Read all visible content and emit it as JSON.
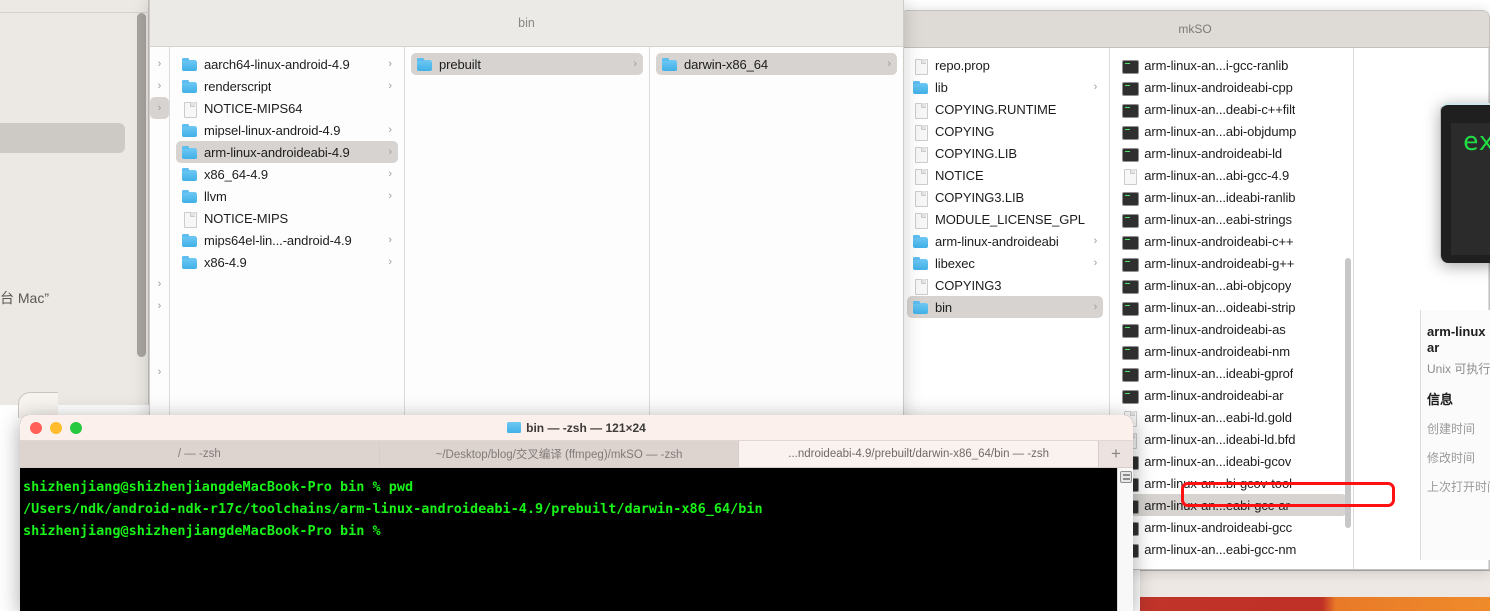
{
  "windows": {
    "bin_window": {
      "title": "bin"
    },
    "mkso_window": {
      "title": "mkSO"
    },
    "left_window": {
      "fragment_text": "台 Mac”"
    },
    "right_terminal_sliver": {
      "text": "ex"
    }
  },
  "finder": {
    "column_1_chevron_only": {
      "note": "",
      "rows": [
        {
          "chevron": "›",
          "selected": false
        },
        {
          "chevron": "›",
          "selected": false
        },
        {
          "chevron": "›",
          "selected": true
        },
        {
          "chevron": "",
          "selected": false
        },
        {
          "chevron": "",
          "selected": false
        },
        {
          "chevron": "",
          "selected": false
        },
        {
          "chevron": "",
          "selected": false
        },
        {
          "chevron": "",
          "selected": false
        },
        {
          "chevron": "",
          "selected": false
        },
        {
          "chevron": "",
          "selected": false
        },
        {
          "chevron": "›",
          "selected": false
        },
        {
          "chevron": "›",
          "selected": false
        },
        {
          "chevron": "",
          "selected": false
        },
        {
          "chevron": "",
          "selected": false
        },
        {
          "chevron": "›",
          "selected": false
        },
        {
          "chevron": "",
          "selected": false
        },
        {
          "chevron": "",
          "selected": false
        },
        {
          "chevron": "›",
          "selected": false
        },
        {
          "chevron": "›",
          "selected": false
        },
        {
          "chevron": "›",
          "selected": false
        }
      ]
    },
    "column_toolchains": {
      "items": [
        {
          "name": "aarch64-linux-android-4.9",
          "icon": "folder-icon",
          "chevron": "›",
          "selected": false
        },
        {
          "name": "renderscript",
          "icon": "folder-icon",
          "chevron": "›",
          "selected": false
        },
        {
          "name": "NOTICE-MIPS64",
          "icon": "document-icon",
          "chevron": "",
          "selected": false
        },
        {
          "name": "mipsel-linux-android-4.9",
          "icon": "folder-icon",
          "chevron": "›",
          "selected": false
        },
        {
          "name": "arm-linux-androideabi-4.9",
          "icon": "folder-icon",
          "chevron": "›",
          "selected": true
        },
        {
          "name": "x86_64-4.9",
          "icon": "folder-icon",
          "chevron": "›",
          "selected": false
        },
        {
          "name": "llvm",
          "icon": "folder-icon",
          "chevron": "›",
          "selected": false
        },
        {
          "name": "NOTICE-MIPS",
          "icon": "document-icon",
          "chevron": "",
          "selected": false
        },
        {
          "name": "mips64el-lin...-android-4.9",
          "icon": "folder-icon",
          "chevron": "›",
          "selected": false
        },
        {
          "name": "x86-4.9",
          "icon": "folder-icon",
          "chevron": "›",
          "selected": false
        }
      ]
    },
    "column_prebuilt": {
      "items": [
        {
          "name": "prebuilt",
          "icon": "folder-icon",
          "chevron": "›",
          "selected": true
        }
      ]
    },
    "column_darwin": {
      "items": [
        {
          "name": "darwin-x86_64",
          "icon": "folder-icon",
          "chevron": "›",
          "selected": true
        }
      ]
    },
    "column_darwin_contents": {
      "items": [
        {
          "name": "repo.prop",
          "icon": "document-icon",
          "chevron": "",
          "selected": false
        },
        {
          "name": "lib",
          "icon": "folder-icon",
          "chevron": "›",
          "selected": false
        },
        {
          "name": "COPYING.RUNTIME",
          "icon": "document-icon",
          "chevron": "",
          "selected": false
        },
        {
          "name": "COPYING",
          "icon": "document-icon",
          "chevron": "",
          "selected": false
        },
        {
          "name": "COPYING.LIB",
          "icon": "document-icon",
          "chevron": "",
          "selected": false
        },
        {
          "name": "NOTICE",
          "icon": "document-icon",
          "chevron": "",
          "selected": false
        },
        {
          "name": "COPYING3.LIB",
          "icon": "document-icon",
          "chevron": "",
          "selected": false
        },
        {
          "name": "MODULE_LICENSE_GPL",
          "icon": "document-icon",
          "chevron": "",
          "selected": false
        },
        {
          "name": "arm-linux-androideabi",
          "icon": "folder-icon",
          "chevron": "›",
          "selected": false
        },
        {
          "name": "libexec",
          "icon": "folder-icon",
          "chevron": "›",
          "selected": false
        },
        {
          "name": "COPYING3",
          "icon": "document-icon",
          "chevron": "",
          "selected": false
        },
        {
          "name": "bin",
          "icon": "folder-icon",
          "chevron": "›",
          "selected": true
        }
      ]
    },
    "column_bin_contents": {
      "items": [
        {
          "name": "arm-linux-an...i-gcc-ranlib",
          "icon": "unix-executable-icon",
          "selected": false,
          "highlighted": false
        },
        {
          "name": "arm-linux-androideabi-cpp",
          "icon": "unix-executable-icon",
          "selected": false,
          "highlighted": false
        },
        {
          "name": "arm-linux-an...deabi-c++filt",
          "icon": "unix-executable-icon",
          "selected": false,
          "highlighted": false
        },
        {
          "name": "arm-linux-an...abi-objdump",
          "icon": "unix-executable-icon",
          "selected": false,
          "highlighted": false
        },
        {
          "name": "arm-linux-androideabi-ld",
          "icon": "unix-executable-icon",
          "selected": false,
          "highlighted": false
        },
        {
          "name": "arm-linux-an...abi-gcc-4.9",
          "icon": "document-icon",
          "selected": false,
          "highlighted": false
        },
        {
          "name": "arm-linux-an...ideabi-ranlib",
          "icon": "unix-executable-icon",
          "selected": false,
          "highlighted": false
        },
        {
          "name": "arm-linux-an...eabi-strings",
          "icon": "unix-executable-icon",
          "selected": false,
          "highlighted": false
        },
        {
          "name": "arm-linux-androideabi-c++",
          "icon": "unix-executable-icon",
          "selected": false,
          "highlighted": false
        },
        {
          "name": "arm-linux-androideabi-g++",
          "icon": "unix-executable-icon",
          "selected": false,
          "highlighted": false
        },
        {
          "name": "arm-linux-an...abi-objcopy",
          "icon": "unix-executable-icon",
          "selected": false,
          "highlighted": false
        },
        {
          "name": "arm-linux-an...oideabi-strip",
          "icon": "unix-executable-icon",
          "selected": false,
          "highlighted": false
        },
        {
          "name": "arm-linux-androideabi-as",
          "icon": "unix-executable-icon",
          "selected": false,
          "highlighted": false
        },
        {
          "name": "arm-linux-androideabi-nm",
          "icon": "unix-executable-icon",
          "selected": false,
          "highlighted": false
        },
        {
          "name": "arm-linux-an...ideabi-gprof",
          "icon": "unix-executable-icon",
          "selected": false,
          "highlighted": false
        },
        {
          "name": "arm-linux-androideabi-ar",
          "icon": "unix-executable-icon",
          "selected": false,
          "highlighted": false
        },
        {
          "name": "arm-linux-an...eabi-ld.gold",
          "icon": "document-icon",
          "selected": false,
          "highlighted": false
        },
        {
          "name": "arm-linux-an...ideabi-ld.bfd",
          "icon": "document-icon",
          "selected": false,
          "highlighted": false
        },
        {
          "name": "arm-linux-an...ideabi-gcov",
          "icon": "unix-executable-icon",
          "selected": false,
          "highlighted": false
        },
        {
          "name": "arm-linux-an...bi-gcov-tool",
          "icon": "unix-executable-icon",
          "selected": false,
          "highlighted": false
        },
        {
          "name": "arm-linux-an...eabi-gcc-ar",
          "icon": "unix-executable-icon",
          "selected": true,
          "highlighted": true
        },
        {
          "name": "arm-linux-androideabi-gcc",
          "icon": "unix-executable-icon",
          "selected": false,
          "highlighted": false
        },
        {
          "name": "arm-linux-an...eabi-gcc-nm",
          "icon": "unix-executable-icon",
          "selected": false,
          "highlighted": false
        }
      ]
    }
  },
  "info_panel": {
    "title_line1": "arm-linux",
    "title_line2": "ar",
    "kind": "Unix 可执行",
    "section_header": "信息",
    "fields": [
      "创建时间",
      "修改时间",
      "上次打开时间"
    ]
  },
  "terminal": {
    "title": "bin — -zsh — 121×24",
    "tabs": [
      {
        "label": "/ — -zsh",
        "active": false
      },
      {
        "label": "~/Desktop/blog/交叉编译 (ffmpeg)/mkSO — -zsh",
        "active": false
      },
      {
        "label": "...ndroideabi-4.9/prebuilt/darwin-x86_64/bin — -zsh",
        "active": true
      }
    ],
    "new_tab_label": "+",
    "lines": [
      "shizhenjiang@shizhenjiangdeMacBook-Pro bin % pwd",
      "/Users/ndk/android-ndk-r17c/toolchains/arm-linux-androideabi-4.9/prebuilt/darwin-x86_64/bin",
      "shizhenjiang@shizhenjiangdeMacBook-Pro bin % "
    ]
  },
  "colors": {
    "annotation_red": "#ff1111",
    "terminal_green": "#19f319",
    "folder_blue": "#3fb0e8",
    "selection_gray": "#d6d3d0"
  }
}
